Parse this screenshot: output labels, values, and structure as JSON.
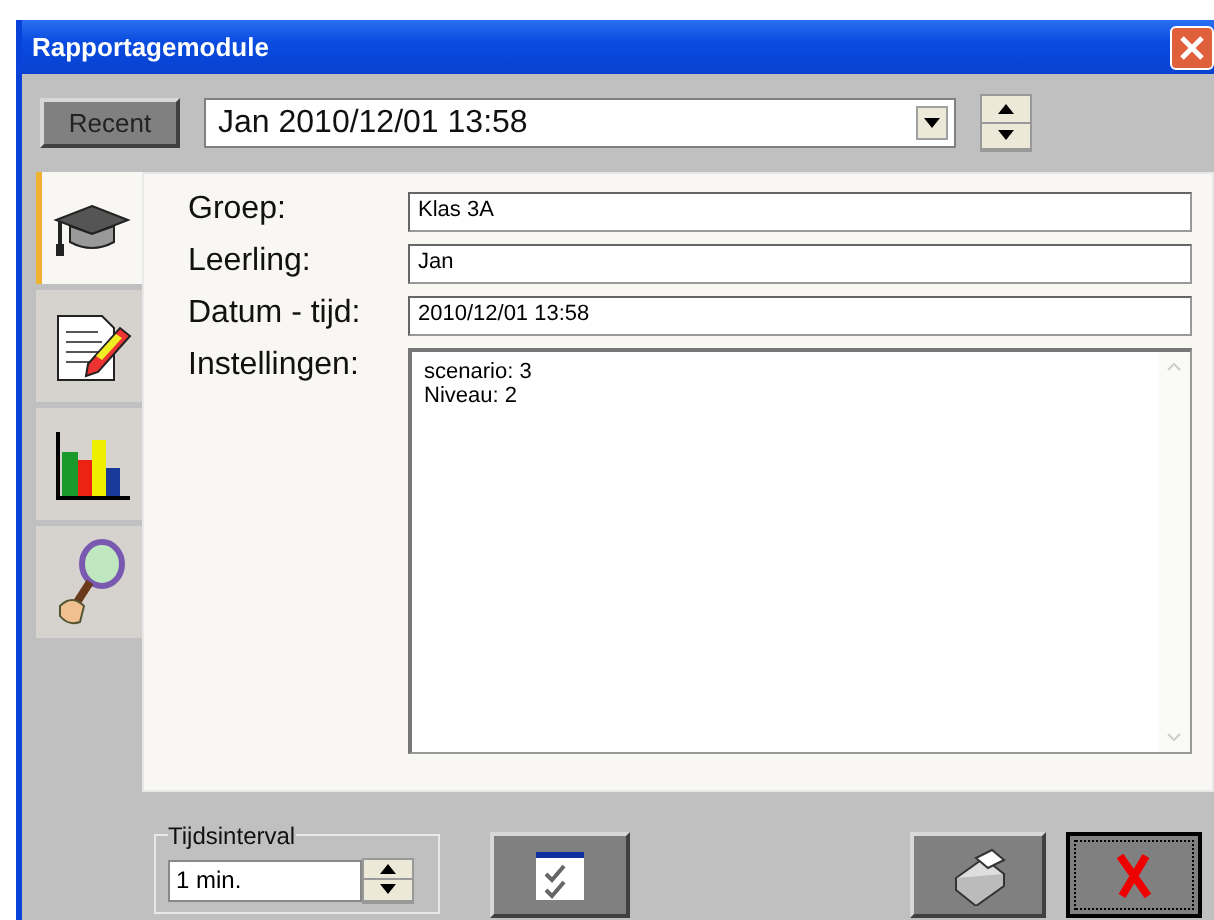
{
  "window": {
    "title": "Rapportagemodule"
  },
  "toolbar": {
    "recent_button": "Recent",
    "session": "Jan 2010/12/01 13:58"
  },
  "tabs": [
    {
      "kind": "student",
      "selected": true
    },
    {
      "kind": "notes",
      "selected": false
    },
    {
      "kind": "chart",
      "selected": false
    },
    {
      "kind": "search",
      "selected": false
    }
  ],
  "form": {
    "fields": [
      {
        "label": "Groep:",
        "value": "Klas 3A"
      },
      {
        "label": "Leerling:",
        "value": "Jan"
      },
      {
        "label": "Datum - tijd:",
        "value": "2010/12/01 13:58"
      }
    ],
    "settings": {
      "label": "Instellingen:",
      "lines": [
        "scenario: 3",
        "Niveau: 2"
      ]
    }
  },
  "interval": {
    "legend": "Tijdsinterval",
    "value": "1 min."
  }
}
